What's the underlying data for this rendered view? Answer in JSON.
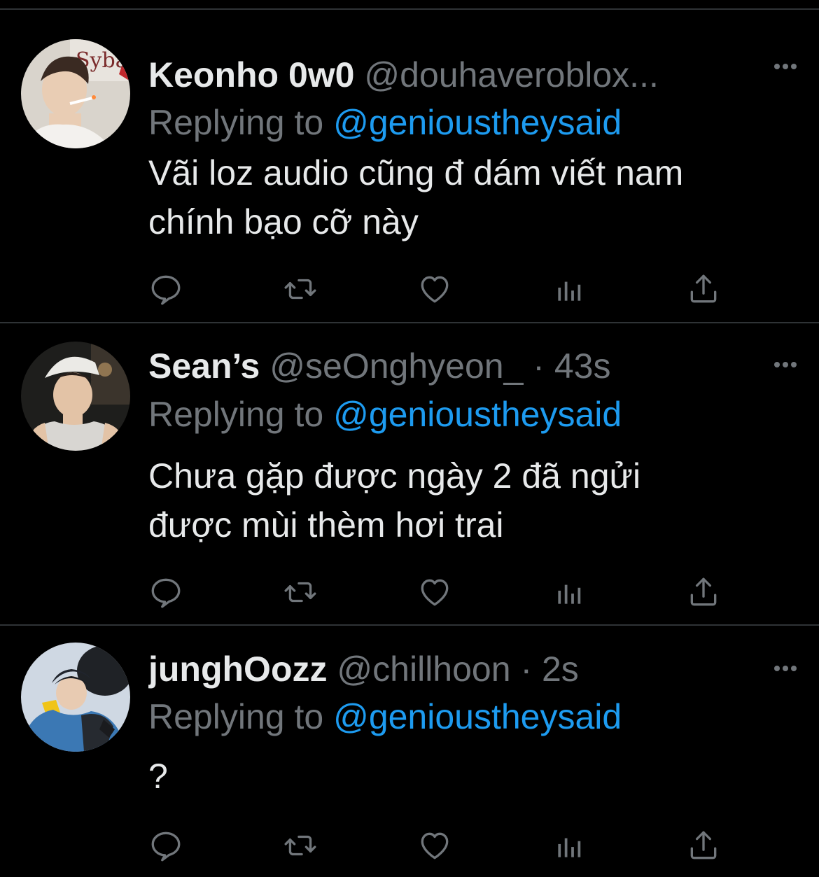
{
  "tweets": [
    {
      "display_name": "Keonho 0w0",
      "handle": "@douhaveroblox...",
      "time": "",
      "reply_prefix": "Replying to",
      "reply_target": "@genioustheysaid",
      "text_lines": [
        "Vãi loz audio cũng đ dám viết nam",
        "chính bạo cỡ này"
      ],
      "avatar_text": "Sybau"
    },
    {
      "display_name": "Sean’s",
      "handle": "@seOnghyeon_",
      "separator": "·",
      "time": "43s",
      "reply_prefix": "Replying to",
      "reply_target": "@genioustheysaid",
      "text_lines": [
        "Chưa gặp được ngày 2 đã ngửi",
        "được mùi thèm hơi trai"
      ]
    },
    {
      "display_name": "junghOozz",
      "handle": "@chillhoon",
      "separator": "·",
      "time": "2s",
      "reply_prefix": "Replying to",
      "reply_target": "@genioustheysaid",
      "text_lines": [
        "?"
      ]
    }
  ],
  "icons": {
    "reply": "speech-bubble-icon",
    "retweet": "retweet-arrows-icon",
    "like": "heart-outline-icon",
    "views": "bar-chart-icon",
    "share": "share-upload-icon",
    "more": "ellipsis-icon"
  },
  "colors": {
    "background": "#000000",
    "text": "#e7e9ea",
    "muted": "#71767b",
    "link": "#1d9bf0",
    "divider": "#2f3336"
  }
}
